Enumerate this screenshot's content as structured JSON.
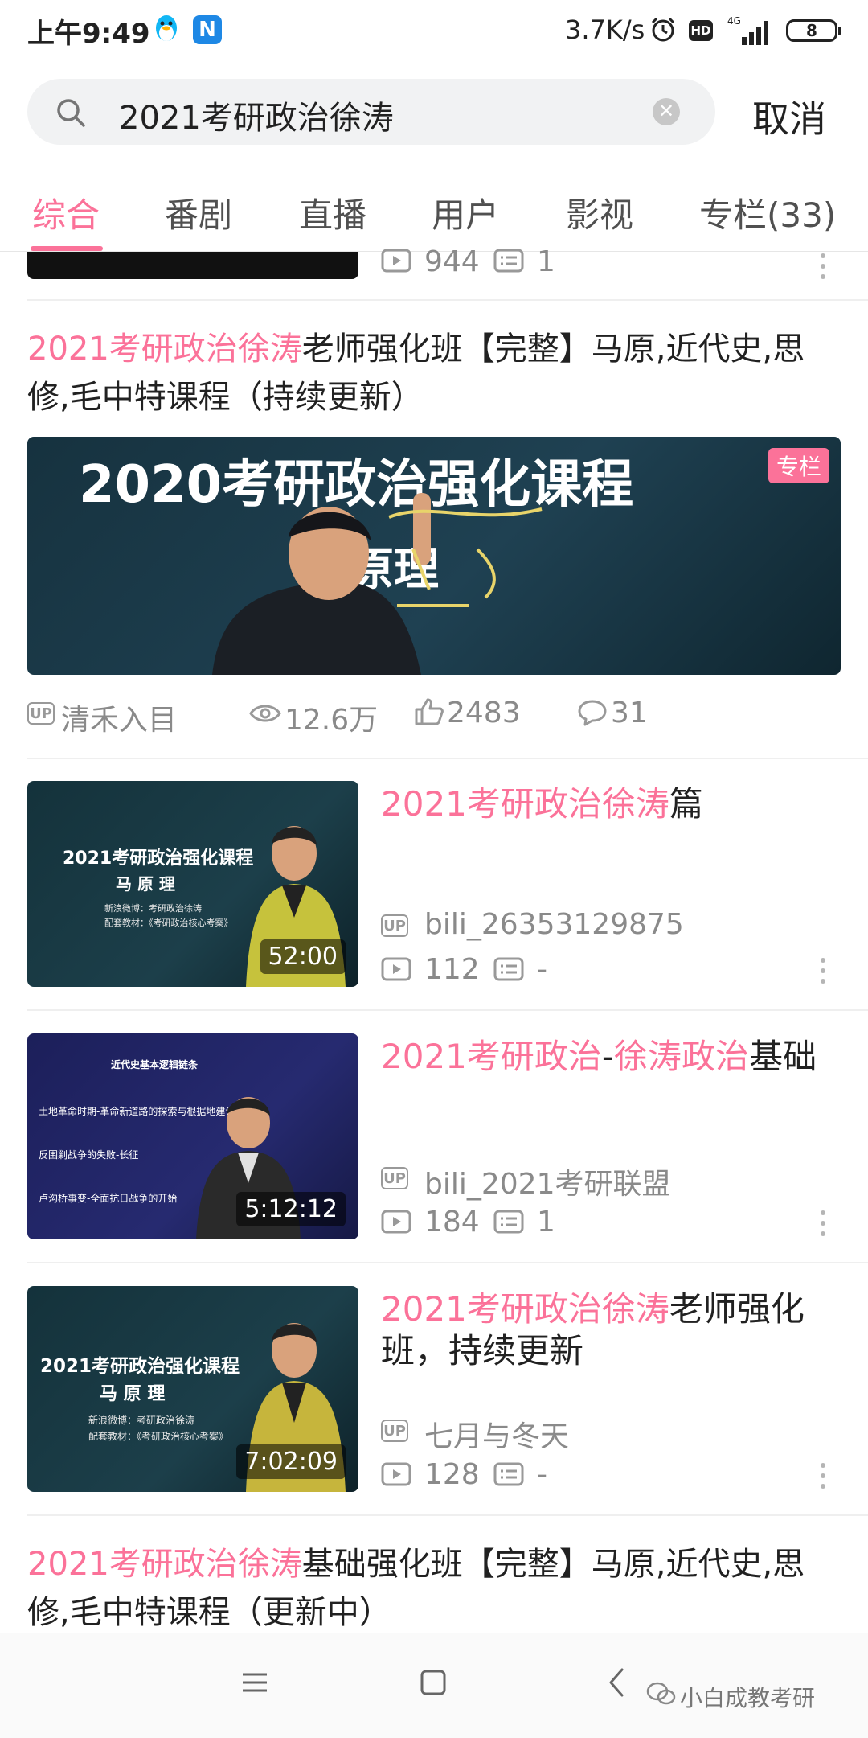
{
  "status_bar": {
    "time": "上午9:49",
    "net_speed": "3.7K/s",
    "hd_label": "HD",
    "network_label": "4G",
    "battery": "8"
  },
  "search": {
    "query": "2021考研政治徐涛",
    "cancel_label": "取消"
  },
  "tabs": [
    "综合",
    "番剧",
    "直播",
    "用户",
    "影视",
    "专栏(33)"
  ],
  "partial_item": {
    "plays": "944",
    "danmaku": "1"
  },
  "article": {
    "title_highlight": "2021考研政治徐涛",
    "title_rest": "老师强化班【完整】马原,近代史,思修,毛中特课程（持续更新）",
    "banner_text": "2020考研政治强化课程",
    "banner_sub": "原理",
    "badge": "专栏",
    "up_badge": "UP",
    "author": "清禾入目",
    "views": "12.6万",
    "likes": "2483",
    "comments": "31"
  },
  "videos": [
    {
      "title_parts": [
        {
          "text": "2021考研政治徐涛",
          "hl": true
        },
        {
          "text": "篇",
          "hl": false
        }
      ],
      "thumb_title": "2021考研政治强化课程",
      "thumb_sub": "马 原 理",
      "thumb_note1": "新浪微博：考研政治徐涛",
      "thumb_note2": "配套教材：《考研政治核心考案》",
      "duration": "52:00",
      "author": "bili_26353129875",
      "plays": "112",
      "danmaku": "-"
    },
    {
      "title_parts": [
        {
          "text": "2021考研政治",
          "hl": true
        },
        {
          "text": "-",
          "hl": false
        },
        {
          "text": "徐涛政治",
          "hl": true
        },
        {
          "text": "基础",
          "hl": false
        }
      ],
      "thumb_title": "近代史基本逻辑链条",
      "thumb_sub": "土地革命时期-革命新道路的探索与根据地建设",
      "thumb_note1": "反围剿战争的失败-长征",
      "thumb_note2": "卢沟桥事变-全面抗日战争的开始",
      "duration": "5:12:12",
      "author": "bili_2021考研联盟",
      "plays": "184",
      "danmaku": "1"
    },
    {
      "title_parts": [
        {
          "text": "2021考研政治徐涛",
          "hl": true
        },
        {
          "text": "老师强化班，持续更新",
          "hl": false
        }
      ],
      "thumb_title": "2021考研政治强化课程",
      "thumb_sub": "马 原 理",
      "thumb_note1": "新浪微博：考研政治徐涛",
      "thumb_note2": "配套教材：《考研政治核心考案》",
      "duration": "7:02:09",
      "author": "七月与冬天",
      "plays": "128",
      "danmaku": "-"
    }
  ],
  "bottom_article": {
    "title_highlight": "2021考研政治徐涛",
    "title_rest": "基础强化班【完整】马原,近代史,思修,毛中特课程（更新中）"
  },
  "watermark": "小白成教考研",
  "colors": {
    "accent": "#fb7299",
    "meta_gray": "#8a8a8a"
  }
}
